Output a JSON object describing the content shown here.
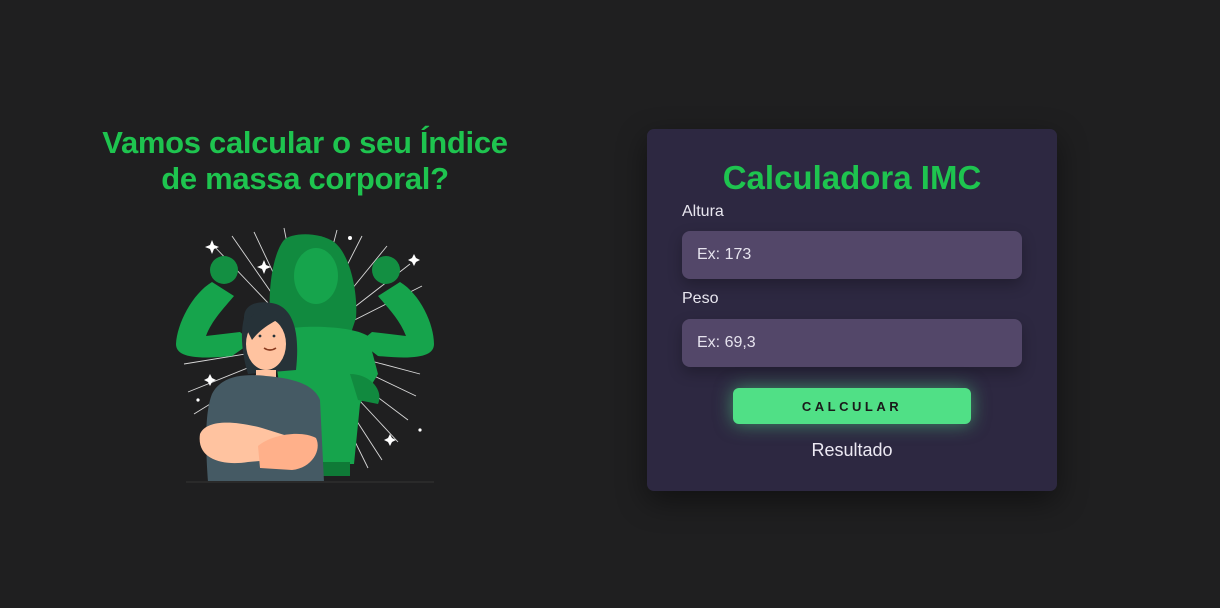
{
  "hero": {
    "headline": "Vamos calcular o seu Índice de massa corporal?"
  },
  "calculator": {
    "title": "Calculadora IMC",
    "height_label": "Altura",
    "height_placeholder": "Ex: 173",
    "weight_label": "Peso",
    "weight_placeholder": "Ex: 69,3",
    "button_label": "CALCULAR",
    "result_text": "Resultado"
  },
  "colors": {
    "background": "#1f1f20",
    "accent_green": "#1ec44f",
    "card": "#2d2841",
    "input": "#534769",
    "button": "#50e086"
  }
}
